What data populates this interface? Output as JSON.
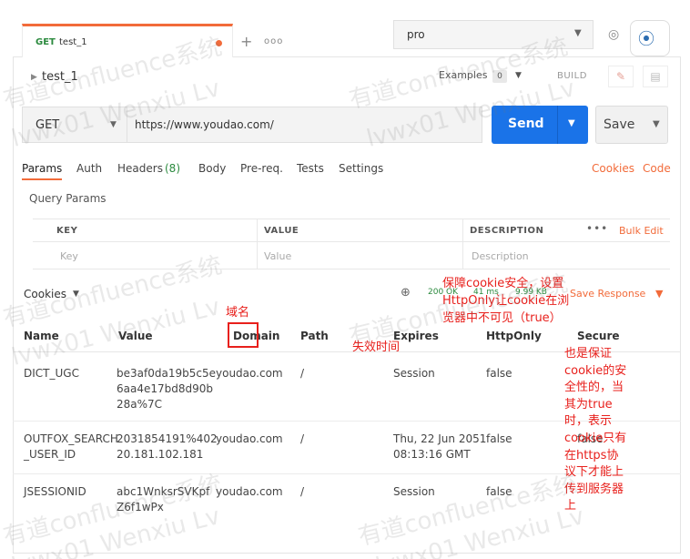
{
  "tab": {
    "method": "GET",
    "name": "test_1"
  },
  "tab_actions": {
    "plus": "+",
    "more": "ooo"
  },
  "environment": {
    "name": "pro"
  },
  "breadcrumb": {
    "name": "test_1"
  },
  "examples": {
    "label": "Examples",
    "count": "0"
  },
  "build_label": "BUILD",
  "request": {
    "method": "GET",
    "url": "https://www.youdao.com/"
  },
  "buttons": {
    "send": "Send",
    "save": "Save"
  },
  "request_tabs": [
    "Params",
    "Auth",
    "Headers",
    "(8)",
    "Body",
    "Pre-req.",
    "Tests",
    "Settings"
  ],
  "right_links": {
    "cookies": "Cookies",
    "code": "Code"
  },
  "query_params": {
    "title": "Query Params",
    "headers": {
      "key": "KEY",
      "value": "VALUE",
      "description": "DESCRIPTION"
    },
    "placeholders": {
      "key": "Key",
      "value": "Value",
      "description": "Description"
    },
    "bulk_edit": "Bulk Edit"
  },
  "response": {
    "tab": "Cookies",
    "status": "200 OK",
    "time": "41 ms",
    "size": "9.99 KB",
    "save_response": "Save Response"
  },
  "cookie_columns": [
    "Name",
    "Value",
    "Domain",
    "Path",
    "Expires",
    "HttpOnly",
    "Secure"
  ],
  "cookies": [
    {
      "name": [
        "DICT_UGC"
      ],
      "value": [
        "be3af0da19b5c5e",
        "6aa4e17bd8d90b",
        "28a%7C"
      ],
      "domain": "youdao.com",
      "path": "/",
      "expires": [
        "Session"
      ],
      "httponly": "false",
      "secure": ""
    },
    {
      "name": [
        "OUTFOX_SEARCH",
        "_USER_ID"
      ],
      "value": [
        "2031854191%402",
        "20.181.102.181"
      ],
      "domain": "youdao.com",
      "path": "/",
      "expires": [
        "Thu, 22 Jun 2051",
        "08:13:16 GMT"
      ],
      "httponly": "false",
      "secure": "false"
    },
    {
      "name": [
        "JSESSIONID"
      ],
      "value": [
        "abc1WnksrSVKpf",
        "Z6f1wPx"
      ],
      "domain": "youdao.com",
      "path": "/",
      "expires": [
        "Session"
      ],
      "httponly": "false",
      "secure": ""
    }
  ],
  "annotations": {
    "domain_cn": "域名",
    "expires_cn": "失效时间",
    "httponly_cn": [
      "保障cookie安全，设置",
      "HttpOnly让cookie在浏",
      "览器中不可见（true）"
    ],
    "secure_cn": [
      "也是保证",
      "cookie的安",
      "全性的，当",
      "其为true",
      "时，表示",
      "cookie只有",
      "在https协",
      "议下才能上",
      "传到服务器",
      "上"
    ]
  },
  "watermark": [
    "有道confluence系统",
    "lvwx01 Wenxiu Lv"
  ],
  "colors": {
    "accent": "#f26b3a",
    "send": "#1a73e8",
    "status_ok": "#2b8a3e",
    "annotation": "#e8201c"
  },
  "icons": [
    "eye-icon",
    "scan-icon",
    "pencil-icon",
    "document-icon",
    "globe-icon",
    "caret-down-icon",
    "caret-right-icon"
  ]
}
